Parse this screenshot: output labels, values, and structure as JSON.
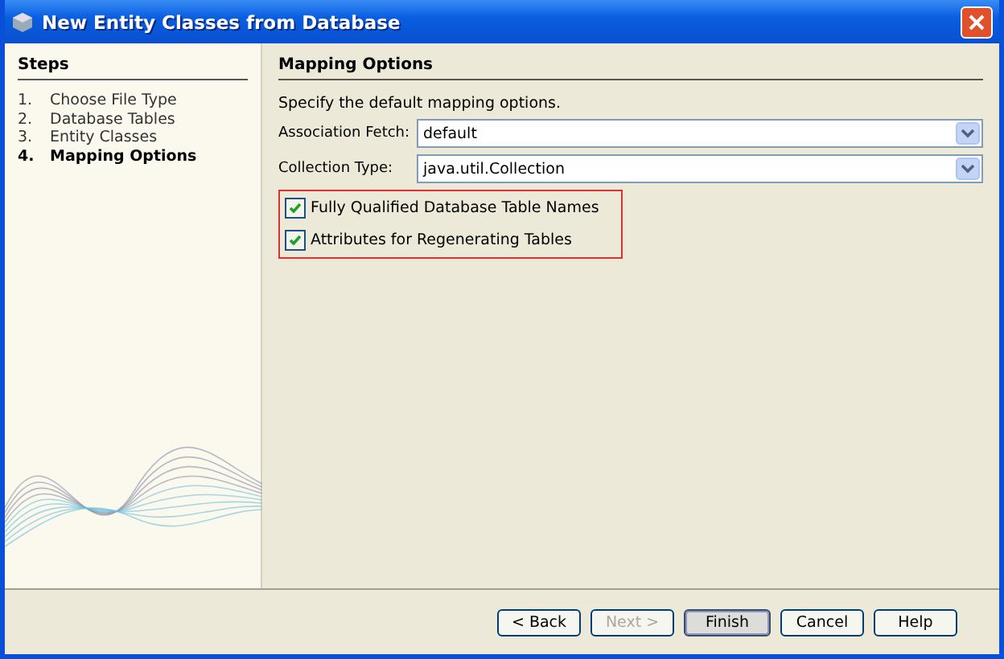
{
  "window": {
    "title": "New Entity Classes from Database"
  },
  "steps": {
    "title": "Steps",
    "items": [
      {
        "number": "1.",
        "label": "Choose File Type",
        "selected": false
      },
      {
        "number": "2.",
        "label": "Database Tables",
        "selected": false
      },
      {
        "number": "3.",
        "label": "Entity Classes",
        "selected": false
      },
      {
        "number": "4.",
        "label": "Mapping Options",
        "selected": true
      }
    ]
  },
  "panel": {
    "title": "Mapping Options",
    "description": "Specify the default mapping options.",
    "fields": [
      {
        "label": "Association Fetch:",
        "value": "default"
      },
      {
        "label": "Collection Type:",
        "value": "java.util.Collection"
      }
    ],
    "options": [
      {
        "label": "Fully Qualified Database Table Names",
        "checked": true
      },
      {
        "label": "Attributes for Regenerating Tables",
        "checked": true
      }
    ]
  },
  "buttons": [
    {
      "label": "< Back",
      "disabled": false,
      "default": false
    },
    {
      "label": "Next >",
      "disabled": true,
      "default": false
    },
    {
      "label": "Finish",
      "disabled": false,
      "default": true
    },
    {
      "label": "Cancel",
      "disabled": false,
      "default": false
    },
    {
      "label": "Help",
      "disabled": false,
      "default": false
    }
  ]
}
